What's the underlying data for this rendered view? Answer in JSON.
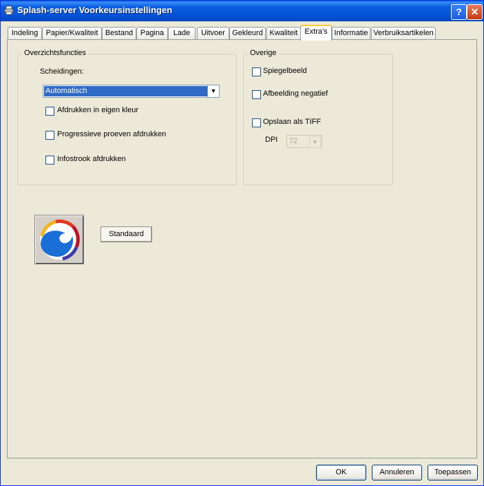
{
  "window": {
    "title": "Splash-server Voorkeursinstellingen"
  },
  "title_buttons": {
    "help": "?",
    "close": "✕"
  },
  "tabs": [
    {
      "label": "Indeling"
    },
    {
      "label": "Papier/Kwaliteit"
    },
    {
      "label": "Bestand"
    },
    {
      "label": "Pagina"
    },
    {
      "label": "Lade"
    },
    {
      "label": "Uitvoer"
    },
    {
      "label": "Gekleurd"
    },
    {
      "label": "Kwaliteit"
    },
    {
      "label": "Extra's"
    },
    {
      "label": "Informatie"
    },
    {
      "label": "Verbruiksartikelen"
    }
  ],
  "active_tab": "Extra's",
  "overview": {
    "group_label": "Overzichtsfuncties",
    "separations_label": "Scheidingen:",
    "separations_value": "Automatisch",
    "checkboxes": [
      {
        "label": "Afdrukken in eigen kleur",
        "checked": false
      },
      {
        "label": "Progressieve proeven afdrukken",
        "checked": false
      },
      {
        "label": "Infostrook afdrukken",
        "checked": false
      }
    ]
  },
  "other": {
    "group_label": "Overige",
    "checkboxes": [
      {
        "label": "Spiegelbeeld",
        "checked": false
      },
      {
        "label": "Afbeelding negatief",
        "checked": false
      },
      {
        "label": "Opslaan als TIFF",
        "checked": false
      }
    ],
    "dpi_label": "DPI",
    "dpi_value": "72"
  },
  "standard_button": "Standaard",
  "footer": {
    "ok": "OK",
    "cancel": "Annuleren",
    "apply": "Toepassen"
  },
  "colors": {
    "titlebar": "#0a5de0",
    "dialog_bg": "#ece9d8",
    "selection": "#316ac5",
    "active_tab_accent": "#ffc83c"
  }
}
